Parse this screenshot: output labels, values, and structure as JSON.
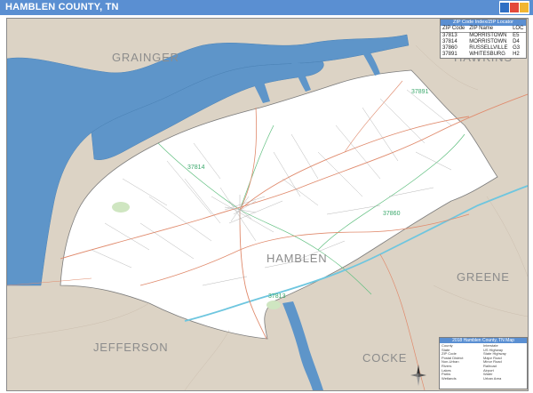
{
  "header": {
    "title": "HAMBLEN COUNTY, TN"
  },
  "map": {
    "county_labels": [
      {
        "name": "county-label-grainger",
        "text": "GRAINGER"
      },
      {
        "name": "county-label-hawkins",
        "text": "HAWKINS"
      },
      {
        "name": "county-label-greene",
        "text": "GREENE"
      },
      {
        "name": "county-label-jefferson",
        "text": "JEFFERSON"
      },
      {
        "name": "county-label-cocke",
        "text": "COCKE"
      },
      {
        "name": "county-label-hamblen",
        "text": "HAMBLEN"
      }
    ],
    "zip_labels": [
      "37814",
      "37813",
      "37860",
      "37891"
    ]
  },
  "zip_table": {
    "title": "ZIP Code Index/ZIP Locator",
    "headers": [
      "ZIP Code",
      "ZIP Name",
      "LOC"
    ],
    "rows": [
      [
        "37813",
        "MORRISTOWN",
        "E5"
      ],
      [
        "37814",
        "MORRISTOWN",
        "D4"
      ],
      [
        "37860",
        "RUSSELLVILLE",
        "G3"
      ],
      [
        "37891",
        "WHITESBURG",
        "H2"
      ]
    ]
  },
  "legend": {
    "title": "2018 Hamblen County, TN Map",
    "rows": [
      [
        "County",
        "Interstate"
      ],
      [
        "State",
        "US Highway"
      ],
      [
        "ZIP Code",
        "State Highway"
      ],
      [
        "Postal District",
        "Major Road"
      ],
      [
        "Non-Urban",
        "Minor Road"
      ],
      [
        "Rivers",
        "Railroad"
      ],
      [
        "Lakes",
        "Airport"
      ],
      [
        "Parks",
        "Water"
      ],
      [
        "Wetlands",
        "Urban Area"
      ]
    ]
  },
  "colors": {
    "header_blue": "#5a8fd2",
    "land_outside": "#dcd3c5",
    "county_fill": "#ffffff",
    "water": "#5e95c9",
    "interstate": "#6ec6df",
    "road_major": "#e08a6c",
    "zip_boundary": "#5fbf7f",
    "road_minor": "#9a9a9a",
    "park": "#cfe6c1",
    "label_gray": "#8c8c8c",
    "zip_label": "#3aa86b"
  }
}
